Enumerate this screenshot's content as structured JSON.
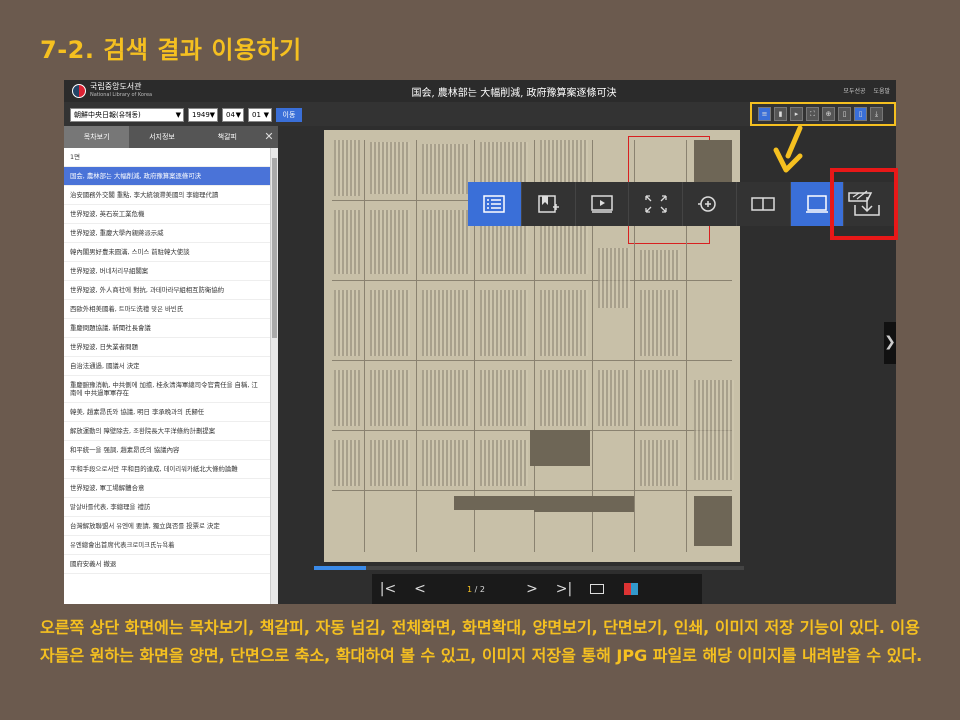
{
  "slide": {
    "title": "7-2. 검색 결과 이용하기",
    "caption": "오른쪽 상단 화면에는 목차보기, 책갈피, 자동 넘김, 전체화면, 화면확대, 양면보기, 단면보기, 인쇄, 이미지 저장 기능이 있다. 이용자들은 원하는 화면을 양면, 단면으로 축소, 확대하여 볼 수 있고, 이미지 저장을 통해 JPG 파일로 해당 이미지를 내려받을 수 있다."
  },
  "app": {
    "logo_name": "국립중앙도서관",
    "logo_sub": "National Library of Korea",
    "doc_title": "国会, 農林部는 大幅削減, 政府豫算案逐條可決",
    "top_links": [
      "모두선공",
      "도움말"
    ],
    "selectors": {
      "newspaper": "朝鮮中央日報(유해동)",
      "year": "1949",
      "month": "04",
      "day": "01",
      "go_label": "이동"
    }
  },
  "sidebar": {
    "tabs": [
      "목차보기",
      "서지정보",
      "책갈피"
    ],
    "active_tab": "목차보기",
    "toc": [
      "1면",
      "国会, 農林部는 大幅削減, 政府豫算案逐條可決",
      "治安國務外交閣 重點, 李大統領滯美國의 李總理代讀",
      "世界短波, 英石炭工業危機",
      "世界短波, 重慶大學內親蔣派示威",
      "韓內閣男好豊未圓滿, 스미스 前駐韓大使談",
      "世界短波, 버네처리부組閣案",
      "世界短波, 外人商社에 對抗, 과테마라부組相互防衛協約",
      "西歐外相美國着, 트마도洗禮 맞은 바빈氏",
      "重慶問題協議, 新聞社長會議",
      "世界短波, 日失業者問題",
      "自治法通過, 國議서 決定",
      "重慶腑豫消軌, 中共側에 加擔, 桂永淸海軍總司令官責任을 自稱, 江南에 中共過軍軍存在",
      "韓美, 趙素昂氏와 協議, 明日 李承晩과의 氏歸任",
      "解放運動의 障壁除去, 조환院長大平洋條約計劃提案",
      "和平統一을 强調, 趙素昂氏의 協議內容",
      "平和手段으로서만 平和目的達成, 데이리워카紙北大條約論難",
      "世界短波, 軍工場解體合意",
      "말살바를代表, 李總理을 禮訪",
      "台灣解放聯盟서 유엔에 要請, 獨立與否를 投票로 決定",
      "유엔總會出首席代表크로미크氏뉴욕着",
      "國府安義서 撤退"
    ]
  },
  "viewer": {
    "page_current": "1",
    "page_total": "/ 2",
    "progress_percent": 12
  },
  "toolbar": {
    "buttons": [
      {
        "name": "목차보기",
        "icon": "toc-list-icon",
        "active": true
      },
      {
        "name": "책갈피",
        "icon": "bookmark-add-icon",
        "active": false
      },
      {
        "name": "자동 넘김",
        "icon": "slideshow-play-icon",
        "active": false
      },
      {
        "name": "전체화면",
        "icon": "fullscreen-icon",
        "active": false
      },
      {
        "name": "화면확대",
        "icon": "zoom-in-icon",
        "active": false
      },
      {
        "name": "양면보기",
        "icon": "two-page-icon",
        "active": false
      },
      {
        "name": "단면보기",
        "icon": "single-page-icon",
        "active": true
      },
      {
        "name": "이미지 저장",
        "icon": "image-download-icon",
        "active": false
      }
    ]
  },
  "colors": {
    "background": "#6b5a4e",
    "accent_yellow": "#f5c020",
    "active_blue": "#3a6fd8",
    "highlight_red": "#e81818"
  }
}
